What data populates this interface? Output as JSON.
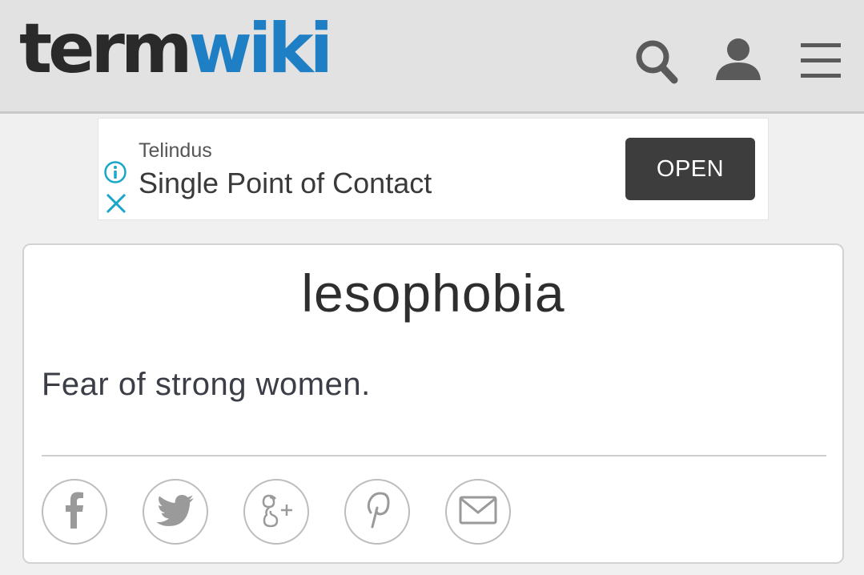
{
  "header": {
    "logo_term": "term",
    "logo_wiki": "wiki",
    "icons": [
      "search-icon",
      "user-icon",
      "hamburger-menu-icon"
    ]
  },
  "ad": {
    "sponsor": "Telindus",
    "title": "Single Point of Contact",
    "open_label": "OPEN",
    "icons": [
      "info-icon",
      "close-icon"
    ]
  },
  "entry": {
    "term": "lesophobia",
    "definition": "Fear of strong women."
  },
  "share": {
    "icons": [
      "facebook-icon",
      "twitter-icon",
      "google-plus-icon",
      "pinterest-icon",
      "email-icon"
    ]
  },
  "colors": {
    "brand_dark": "#2a2a2a",
    "brand_blue": "#1f7fc4",
    "ad_accent": "#1aa6c8",
    "button_dark": "#3d3d3d"
  }
}
